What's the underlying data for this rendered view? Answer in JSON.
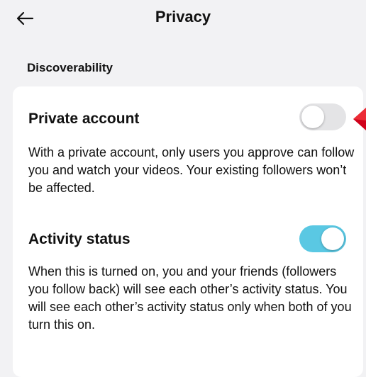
{
  "header": {
    "back_icon": "arrow-left-icon",
    "title": "Privacy"
  },
  "section": {
    "label": "Discoverability"
  },
  "settings": [
    {
      "title": "Private account",
      "description": "With a private account, only users you approve can follow you and watch your videos. Your existing followers won’t be affected.",
      "enabled": false
    },
    {
      "title": "Activity status",
      "description": "When this is turned on, you and your friends (followers you follow back) will see each other’s activity status. You will see each other’s activity status only when both of you turn this on.",
      "enabled": true
    }
  ],
  "colors": {
    "toggle_on": "#5ac8e3",
    "toggle_off": "#e4e4e6",
    "background": "#f2f2f4",
    "pointer": "#d0021b"
  }
}
